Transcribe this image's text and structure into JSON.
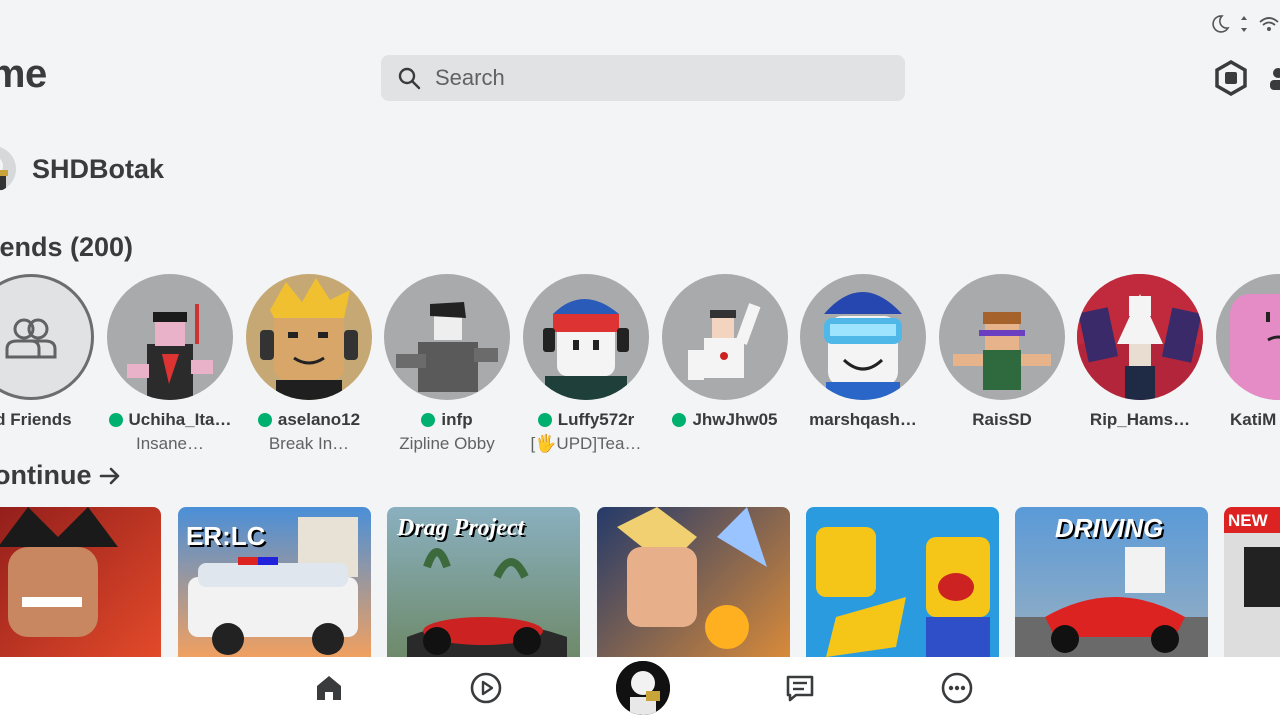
{
  "header": {
    "title": "ome",
    "search_placeholder": "Search",
    "robux_icon": "robux-icon"
  },
  "user": {
    "name": "SHDBotak"
  },
  "friends": {
    "title": "iends (200)",
    "add_label": "ld Friends",
    "items": [
      {
        "name": "Uchiha_Ita…",
        "status": "Insane…",
        "online": true
      },
      {
        "name": "aselano12",
        "status": "Break In…",
        "online": true
      },
      {
        "name": "infp",
        "status": "Zipline Obby",
        "online": true
      },
      {
        "name": "Luffy572r",
        "status": "[🖐UPD]Tea…",
        "online": true
      },
      {
        "name": "JhwJhw05",
        "status": "",
        "online": true
      },
      {
        "name": "marshqash…",
        "status": "",
        "online": false
      },
      {
        "name": "RaisSD",
        "status": "",
        "online": false
      },
      {
        "name": "Rip_Hams…",
        "status": "",
        "online": false
      },
      {
        "name": "KatiM",
        "status": "",
        "online": false
      }
    ]
  },
  "continue": {
    "title": "ontinue",
    "games": [
      {
        "label": ""
      },
      {
        "label": "ER:LC"
      },
      {
        "label": "Drag Project"
      },
      {
        "label": ""
      },
      {
        "label": ""
      },
      {
        "label": "DRIVING"
      },
      {
        "label": "NEW"
      }
    ]
  },
  "nav": {
    "items": [
      "home-icon",
      "play-icon",
      "avatar",
      "chat-icon",
      "more-icon"
    ]
  },
  "colors": {
    "background": "#f2f4f5",
    "online": "#00b06f",
    "text": "#393b3d",
    "muted": "#606264"
  }
}
